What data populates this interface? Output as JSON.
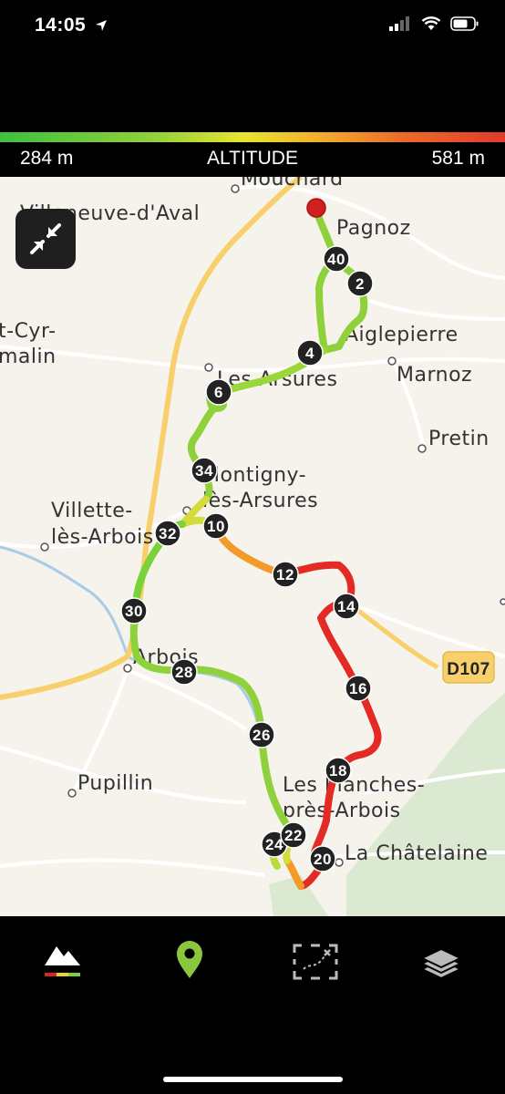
{
  "status_bar": {
    "time": "14:05"
  },
  "altitude": {
    "min": "284 m",
    "label": "ALTITUDE",
    "max": "581 m"
  },
  "map": {
    "places": [
      "Mouchard",
      "Pagnoz",
      "Villeneuve-d'Aval",
      "Aiglepierre",
      "Marnoz",
      "Les Arsures",
      "Pretin",
      "Montigny-",
      "lès-Arsures",
      "Villette-",
      "lès-Arbois",
      "Arbois",
      "Pupillin",
      "Les Planches-",
      "près-Arbois",
      "La Châtelaine",
      "t-Cyr-",
      "malin"
    ],
    "road_label": "D107",
    "km_markers": [
      "40",
      "2",
      "4",
      "6",
      "34",
      "10",
      "32",
      "12",
      "14",
      "30",
      "28",
      "16",
      "26",
      "18",
      "24",
      "22",
      "20"
    ]
  },
  "colors": {
    "route_low": "#7ad13a",
    "route_mid": "#f29a2a",
    "route_high": "#e42a24",
    "tab_active": "#8cc63f"
  },
  "tabs": [
    {
      "name": "altitude-profile",
      "icon": "mountain-icon"
    },
    {
      "name": "location",
      "icon": "map-pin-icon"
    },
    {
      "name": "route-focus",
      "icon": "route-frame-icon"
    },
    {
      "name": "layers",
      "icon": "layers-icon"
    }
  ]
}
